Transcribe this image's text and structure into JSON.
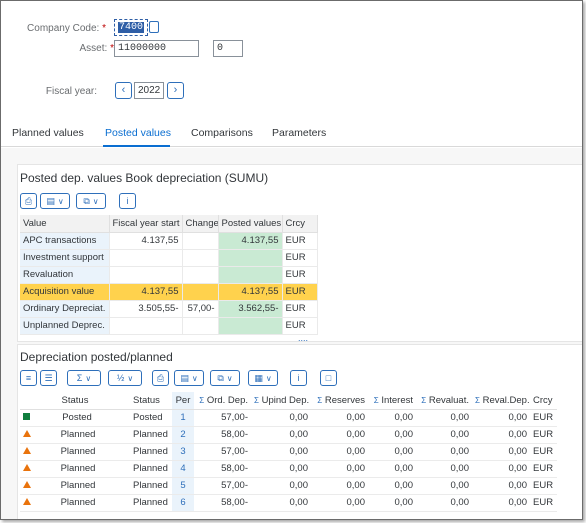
{
  "header": {
    "company_code_label": "Company Code:",
    "company_code_value": "7400",
    "asset_label": "Asset:",
    "asset_value": "11000000",
    "asset_sub_value": "0",
    "fiscal_year_label": "Fiscal year:",
    "fiscal_year_value": "2022",
    "required_mark": "*",
    "prev_glyph": "‹",
    "next_glyph": "›"
  },
  "tabs": [
    "Planned values",
    "Posted values",
    "Comparisons",
    "Parameters"
  ],
  "active_tab": "Posted values",
  "panel1": {
    "title": "Posted dep. values Book depreciation (SUMU)",
    "columns": [
      "Value",
      "Fiscal year start",
      "Change",
      "Posted values",
      "Crcy"
    ],
    "rows": [
      {
        "value": "APC transactions",
        "start": "4.137,55",
        "change": "",
        "posted": "4.137,55",
        "crcy": "EUR"
      },
      {
        "value": "Investment support",
        "start": "",
        "change": "",
        "posted": "",
        "crcy": "EUR"
      },
      {
        "value": "Revaluation",
        "start": "",
        "change": "",
        "posted": "",
        "crcy": "EUR"
      },
      {
        "value": "Acquisition value",
        "start": "4.137,55",
        "change": "",
        "posted": "4.137,55",
        "crcy": "EUR"
      },
      {
        "value": "Ordinary Depreciat.",
        "start": "3.505,55-",
        "change": "57,00-",
        "posted": "3.562,55-",
        "crcy": "EUR"
      },
      {
        "value": "Unplanned Deprec.",
        "start": "",
        "change": "",
        "posted": "",
        "crcy": "EUR"
      }
    ],
    "resize_handle": "...."
  },
  "panel2": {
    "title": "Depreciation posted/planned",
    "columns": [
      "Status",
      "Status",
      "Per",
      "Ord. Dep.",
      "Upind Dep.",
      "Reserves",
      "Interest",
      "Revaluat.",
      "Reval.Dep.",
      "Crcy"
    ],
    "sum_glyph": "Σ",
    "rows": [
      {
        "icon": "posted",
        "status_text": "Posted",
        "status": "Posted",
        "per": "1",
        "ord": "57,00-",
        "upind": "0,00",
        "reserves": "0,00",
        "interest": "0,00",
        "revaluat": "0,00",
        "revaldep": "0,00",
        "crcy": "EUR"
      },
      {
        "icon": "planned",
        "status_text": "Planned",
        "status": "Planned",
        "per": "2",
        "ord": "58,00-",
        "upind": "0,00",
        "reserves": "0,00",
        "interest": "0,00",
        "revaluat": "0,00",
        "revaldep": "0,00",
        "crcy": "EUR"
      },
      {
        "icon": "planned",
        "status_text": "Planned",
        "status": "Planned",
        "per": "3",
        "ord": "57,00-",
        "upind": "0,00",
        "reserves": "0,00",
        "interest": "0,00",
        "revaluat": "0,00",
        "revaldep": "0,00",
        "crcy": "EUR"
      },
      {
        "icon": "planned",
        "status_text": "Planned",
        "status": "Planned",
        "per": "4",
        "ord": "58,00-",
        "upind": "0,00",
        "reserves": "0,00",
        "interest": "0,00",
        "revaluat": "0,00",
        "revaldep": "0,00",
        "crcy": "EUR"
      },
      {
        "icon": "planned",
        "status_text": "Planned",
        "status": "Planned",
        "per": "5",
        "ord": "57,00-",
        "upind": "0,00",
        "reserves": "0,00",
        "interest": "0,00",
        "revaluat": "0,00",
        "revaldep": "0,00",
        "crcy": "EUR"
      },
      {
        "icon": "planned",
        "status_text": "Planned",
        "status": "Planned",
        "per": "6",
        "ord": "58,00-",
        "upind": "0,00",
        "reserves": "0,00",
        "interest": "0,00",
        "revaluat": "0,00",
        "revaldep": "0,00",
        "crcy": "EUR"
      }
    ]
  },
  "colors": {
    "accent": "#0a6ed1",
    "highlight_row": "#ffd24d",
    "posted_cell": "#c9ead3",
    "key_cell": "#eaf3fb",
    "posted_icon": "#107e3e",
    "planned_icon": "#e9730c"
  }
}
